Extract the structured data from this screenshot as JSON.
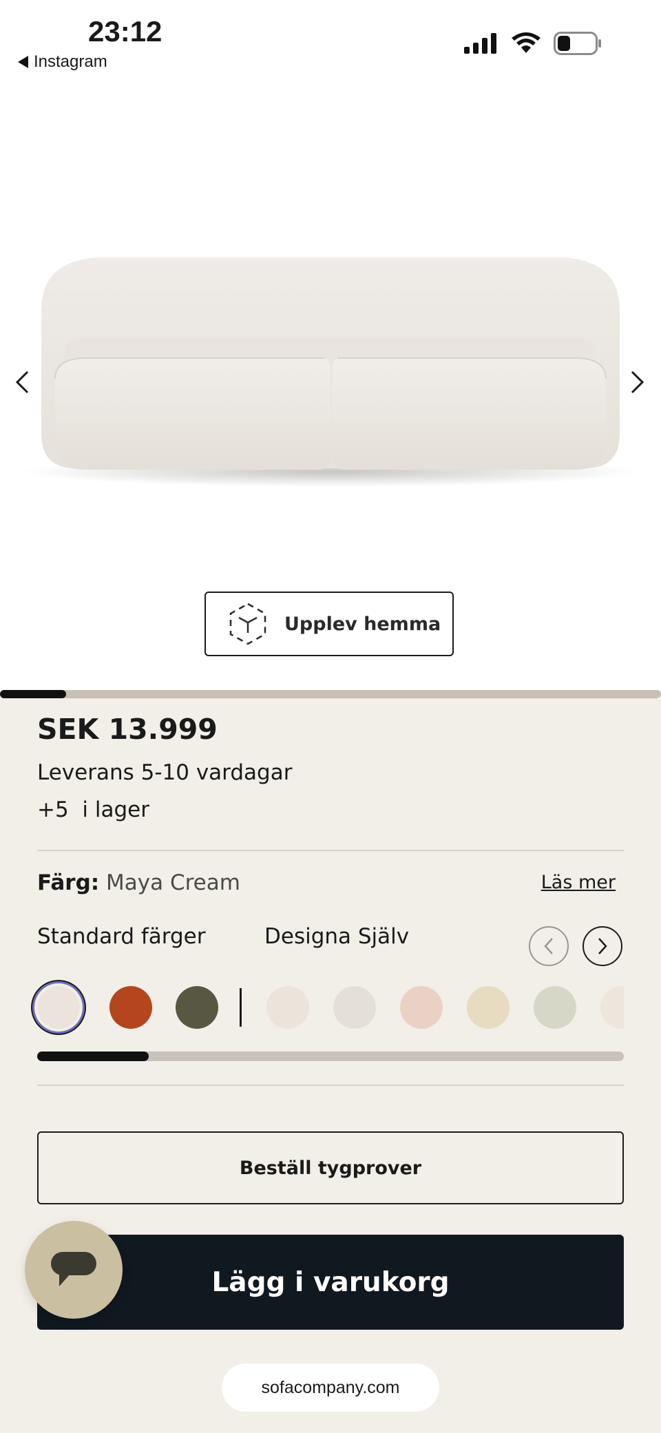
{
  "status_bar": {
    "time": "23:12",
    "back_app": "Instagram",
    "icons": [
      "cellular-signal-icon",
      "wifi-icon",
      "battery-icon"
    ]
  },
  "gallery": {
    "progress_fraction": 0.1,
    "ar_button_label": "Upplev hemma"
  },
  "product": {
    "price": "SEK 13.999",
    "delivery": "Leverans 5-10 vardagar",
    "stock": "+5  i lager"
  },
  "color": {
    "label": "Färg:",
    "value": "Maya Cream",
    "read_more": "Läs mer",
    "tabs": [
      "Standard färger",
      "Designa Själv"
    ],
    "standard_swatches": [
      "#ece4dc",
      "#b4461d",
      "#585742"
    ],
    "custom_swatches": [
      "#ece3da",
      "#e5e0d7",
      "#e9d1c6",
      "#e7dcc0",
      "#d7d7c8",
      "#ece6dc"
    ],
    "selected_index": 0,
    "scroll_fraction": 0.19
  },
  "actions": {
    "samples_label": "Beställ tygprover",
    "cart_label": "Lägg i varukorg"
  },
  "browser": {
    "url": "sofacompany.com"
  },
  "colors": {
    "panel_bg": "#f2eee8",
    "cart_bg": "#101820",
    "chat_bg": "#cbbfa1"
  }
}
